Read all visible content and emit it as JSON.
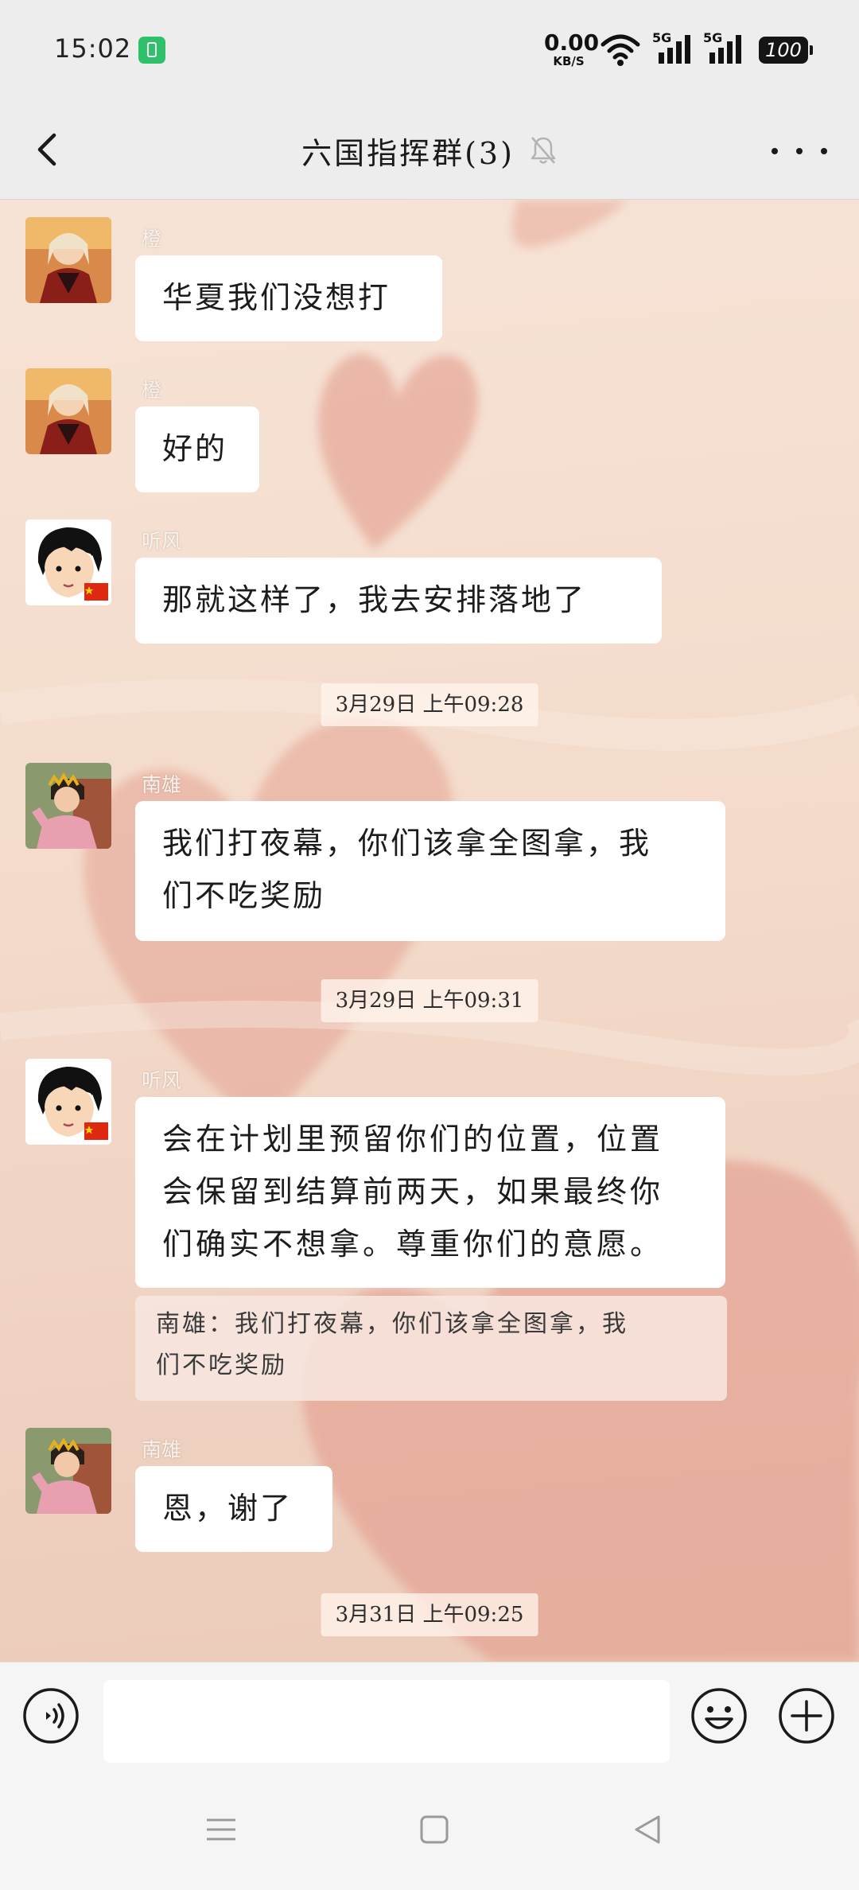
{
  "status_bar": {
    "time": "15:02",
    "net_speed_value": "0.00",
    "net_speed_unit": "KB/S",
    "signal_1_label": "5G",
    "signal_2_label": "5G",
    "battery": "100"
  },
  "header": {
    "title": "六国指挥群(3)"
  },
  "messages": [
    {
      "sender": "橙",
      "text": "华夏我们没想打"
    },
    {
      "sender": "橙",
      "text": "好的"
    },
    {
      "sender": "听风",
      "text": "那就这样了，我去安排落地了"
    },
    {
      "sender": "南雄",
      "lines": [
        "我们打夜幕，你们该拿全图拿，我",
        "们不吃奖励"
      ]
    },
    {
      "sender": "听风",
      "lines": [
        "会在计划里预留你们的位置，位置",
        "会保留到结算前两天，如果最终你",
        "们确实不想拿。尊重你们的意愿。"
      ],
      "quote_lines": [
        "南雄：我们打夜幕，你们该拿全图拿，我",
        "们不吃奖励"
      ]
    },
    {
      "sender": "南雄",
      "text": "恩，谢了"
    }
  ],
  "timestamps": [
    "3月29日 上午09:28",
    "3月29日 上午09:31",
    "3月31日 上午09:25"
  ],
  "colors": {
    "bubble": "#ffffff",
    "chat_background": "#f4dccc",
    "heart": "#e39c8c",
    "bar_background": "#ededed"
  }
}
